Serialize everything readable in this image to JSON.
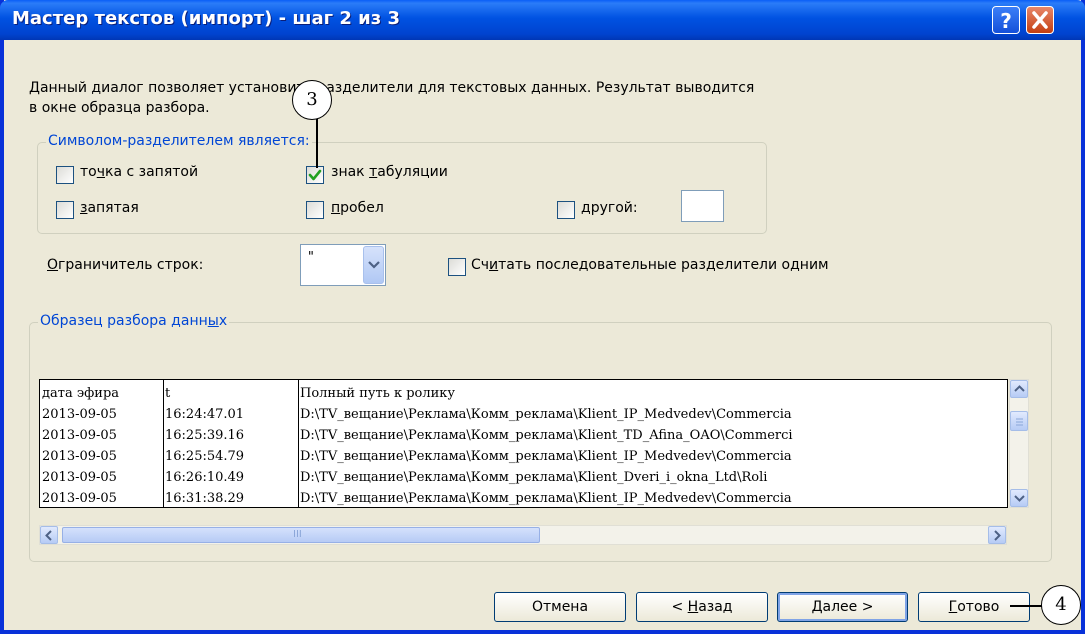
{
  "window": {
    "title": "Мастер текстов (импорт) - шаг 2 из 3",
    "help_button": "?",
    "close_button": "✕"
  },
  "description": {
    "line1": "Данный диалог позволяет установить разделители для текстовых данных. Результат выводится",
    "line2": "в окне образца разбора."
  },
  "delimiters": {
    "legend": "Символом-разделителем является:",
    "semicolon": {
      "pre": "то",
      "acc": "ч",
      "post": "ка с запятой",
      "checked": false
    },
    "comma": {
      "pre": "",
      "acc": "з",
      "post": "апятая",
      "checked": false
    },
    "tab": {
      "pre": "знак ",
      "acc": "т",
      "post": "абуляции",
      "checked": true
    },
    "space": {
      "pre": "",
      "acc": "п",
      "post": "робел",
      "checked": false
    },
    "other": {
      "pre": "",
      "acc": "д",
      "post": "ругой:",
      "checked": false,
      "value": ""
    }
  },
  "text_qualifier": {
    "label_pre": "",
    "label_acc": "О",
    "label_post": "граничитель строк:",
    "value": "\""
  },
  "consecutive": {
    "label_pre": "Сч",
    "label_acc": "и",
    "label_post": "тать последовательные разделители одним",
    "checked": false
  },
  "preview": {
    "legend_pre": "Образец разбора данн",
    "legend_acc": "ы",
    "legend_post": "х",
    "rows": [
      [
        "дата эфира",
        "t",
        "Полный путь к ролику"
      ],
      [
        "2013-09-05",
        "16:24:47.01",
        "D:\\TV_вещание\\Реклама\\Комм_реклама\\Klient_IP_Medvedev\\Commercia"
      ],
      [
        "2013-09-05",
        "16:25:39.16",
        "D:\\TV_вещание\\Реклама\\Комм_реклама\\Klient_TD_Afina_OAO\\Commerci"
      ],
      [
        "2013-09-05",
        "16:25:54.79",
        "D:\\TV_вещание\\Реклама\\Комм_реклама\\Klient_IP_Medvedev\\Commercia"
      ],
      [
        "2013-09-05",
        "16:26:10.49",
        "D:\\TV_вещание\\Реклама\\Комм_реклама\\Klient_Dveri_i_okna_Ltd\\Roli"
      ],
      [
        "2013-09-05",
        "16:31:38.29",
        "D:\\TV_вещание\\Реклама\\Комм_реклама\\Klient_IP_Medvedev\\Commercia"
      ]
    ],
    "hscroll_grip": "III"
  },
  "buttons": {
    "cancel": "Отмена",
    "back_pre": "< ",
    "back_acc": "Н",
    "back_post": "азад",
    "next_pre": "",
    "next_acc": "Д",
    "next_post": "алее >",
    "finish_pre": "",
    "finish_acc": "Г",
    "finish_post": "отово"
  },
  "callouts": {
    "callout_3": "3",
    "callout_4": "4"
  },
  "colors": {
    "titlebar": "#0052e2",
    "window_bg": "#ece9d8",
    "legend_text": "#0046d5",
    "checkmark": "#21a121"
  }
}
